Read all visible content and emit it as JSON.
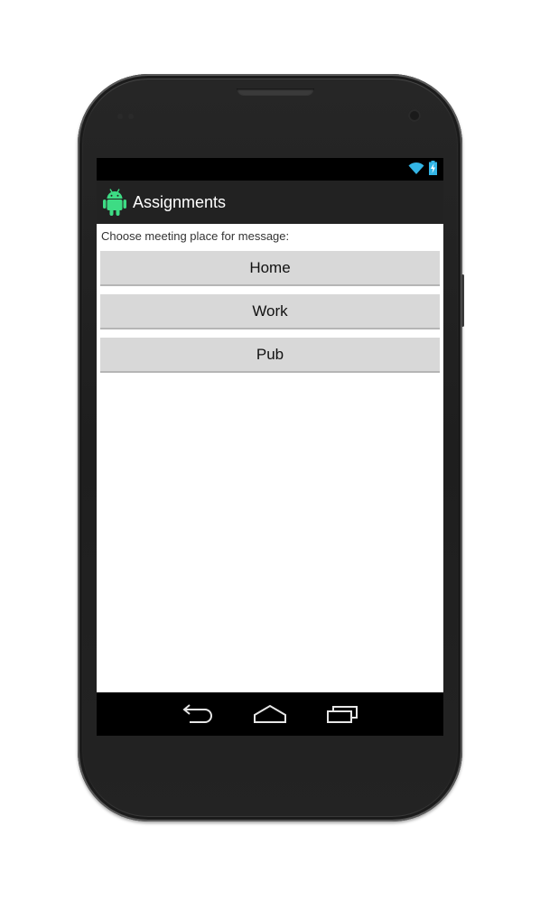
{
  "app": {
    "title": "Assignments",
    "icon": "android-robot-icon",
    "accent_color": "#3ddc84"
  },
  "status_bar": {
    "icons": [
      "wifi-icon",
      "battery-charging-icon"
    ],
    "icon_color": "#33b5e5"
  },
  "content": {
    "prompt": "Choose meeting place for message:",
    "buttons": [
      {
        "label": "Home"
      },
      {
        "label": "Work"
      },
      {
        "label": "Pub"
      }
    ]
  },
  "nav_bar": {
    "items": [
      "back-icon",
      "home-icon",
      "recent-apps-icon"
    ]
  }
}
